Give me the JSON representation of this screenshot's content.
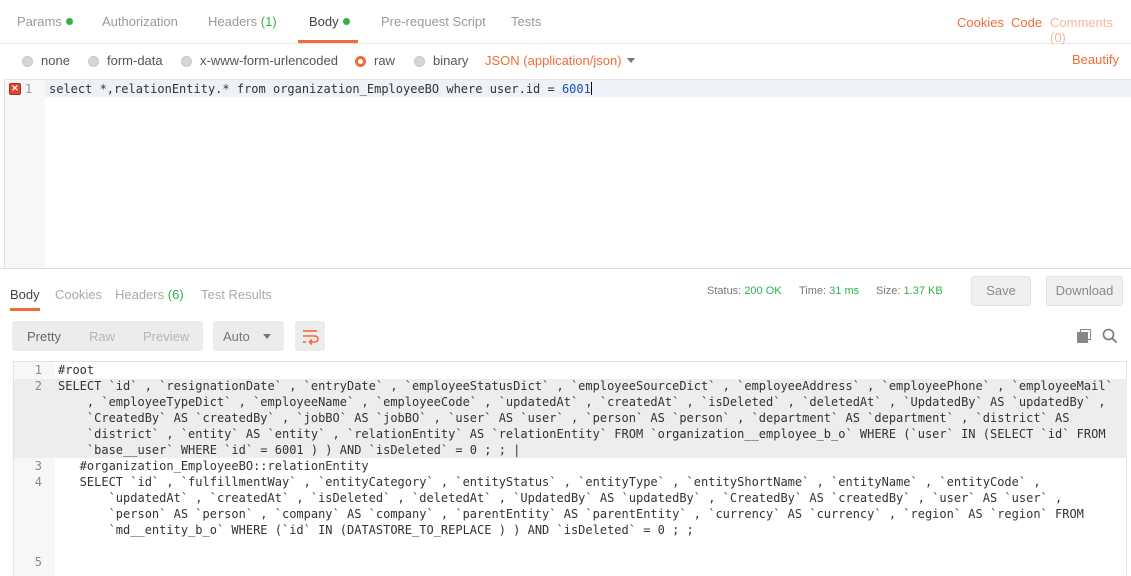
{
  "request_tabs": {
    "params": "Params",
    "authorization": "Authorization",
    "headers": "Headers",
    "headers_count": "(1)",
    "body": "Body",
    "prerequest": "Pre-request Script",
    "tests": "Tests"
  },
  "right_links": {
    "cookies": "Cookies",
    "code": "Code",
    "comments": "Comments (0)"
  },
  "body_options": {
    "none": "none",
    "form_data": "form-data",
    "urlencoded": "x-www-form-urlencoded",
    "raw": "raw",
    "binary": "binary",
    "content_type": "JSON (application/json)",
    "beautify": "Beautify"
  },
  "editor": {
    "line_number": "1",
    "error_icon": "error-x-icon",
    "code_prefix": "select *,relationEntity.* from organization_EmployeeBO where user.id = ",
    "code_number": "6001"
  },
  "response_tabs": {
    "body": "Body",
    "cookies": "Cookies",
    "headers": "Headers",
    "headers_count": "(6)",
    "test_results": "Test Results"
  },
  "response_meta": {
    "status_label": "Status:",
    "status_value": "200 OK",
    "time_label": "Time:",
    "time_value": "31 ms",
    "size_label": "Size:",
    "size_value": "1.37 KB",
    "save": "Save",
    "download": "Download"
  },
  "view": {
    "pretty": "Pretty",
    "raw": "Raw",
    "preview": "Preview",
    "format": "Auto"
  },
  "icons": {
    "wrap": "wrap-lines-icon",
    "copy": "copy-icon",
    "search": "search-icon"
  },
  "colors": {
    "accent": "#f26b3a",
    "success": "#2fb44a",
    "error": "#e0442f"
  },
  "response": {
    "lines": [
      {
        "num": "1",
        "text": "#root"
      },
      {
        "num": "2",
        "text": "SELECT `id` , `resignationDate` , `entryDate` , `employeeStatusDict` , `employeeSourceDict` , `employeeAddress` , `employeePhone` , `employeeMail`"
      },
      {
        "num": "",
        "text": "    , `employeeTypeDict` , `employeeName` , `employeeCode` , `updatedAt` , `createdAt` , `isDeleted` , `deletedAt` , `UpdatedBy` AS `updatedBy` ,"
      },
      {
        "num": "",
        "text": "    `CreatedBy` AS `createdBy` , `jobBO` AS `jobBO` , `user` AS `user` , `person` AS `person` , `department` AS `department` , `district` AS"
      },
      {
        "num": "",
        "text": "    `district` , `entity` AS `entity` , `relationEntity` AS `relationEntity` FROM `organization__employee_b_o` WHERE (`user` IN (SELECT `id` FROM"
      },
      {
        "num": "",
        "text": "    `base__user` WHERE `id` = 6001 ) ) AND `isDeleted` = 0 ; ; |"
      },
      {
        "num": "3",
        "text": "   #organization_EmployeeBO::relationEntity"
      },
      {
        "num": "4",
        "text": "   SELECT `id` , `fulfillmentWay` , `entityCategory` , `entityStatus` , `entityType` , `entityShortName` , `entityName` , `entityCode` ,"
      },
      {
        "num": "",
        "text": "       `updatedAt` , `createdAt` , `isDeleted` , `deletedAt` , `UpdatedBy` AS `updatedBy` , `CreatedBy` AS `createdBy` , `user` AS `user` ,"
      },
      {
        "num": "",
        "text": "       `person` AS `person` , `company` AS `company` , `parentEntity` AS `parentEntity` , `currency` AS `currency` , `region` AS `region` FROM"
      },
      {
        "num": "",
        "text": "       `md__entity_b_o` WHERE (`id` IN (DATASTORE_TO_REPLACE ) ) AND `isDeleted` = 0 ; ;"
      },
      {
        "num": "",
        "text": ""
      },
      {
        "num": "5",
        "text": ""
      }
    ]
  }
}
